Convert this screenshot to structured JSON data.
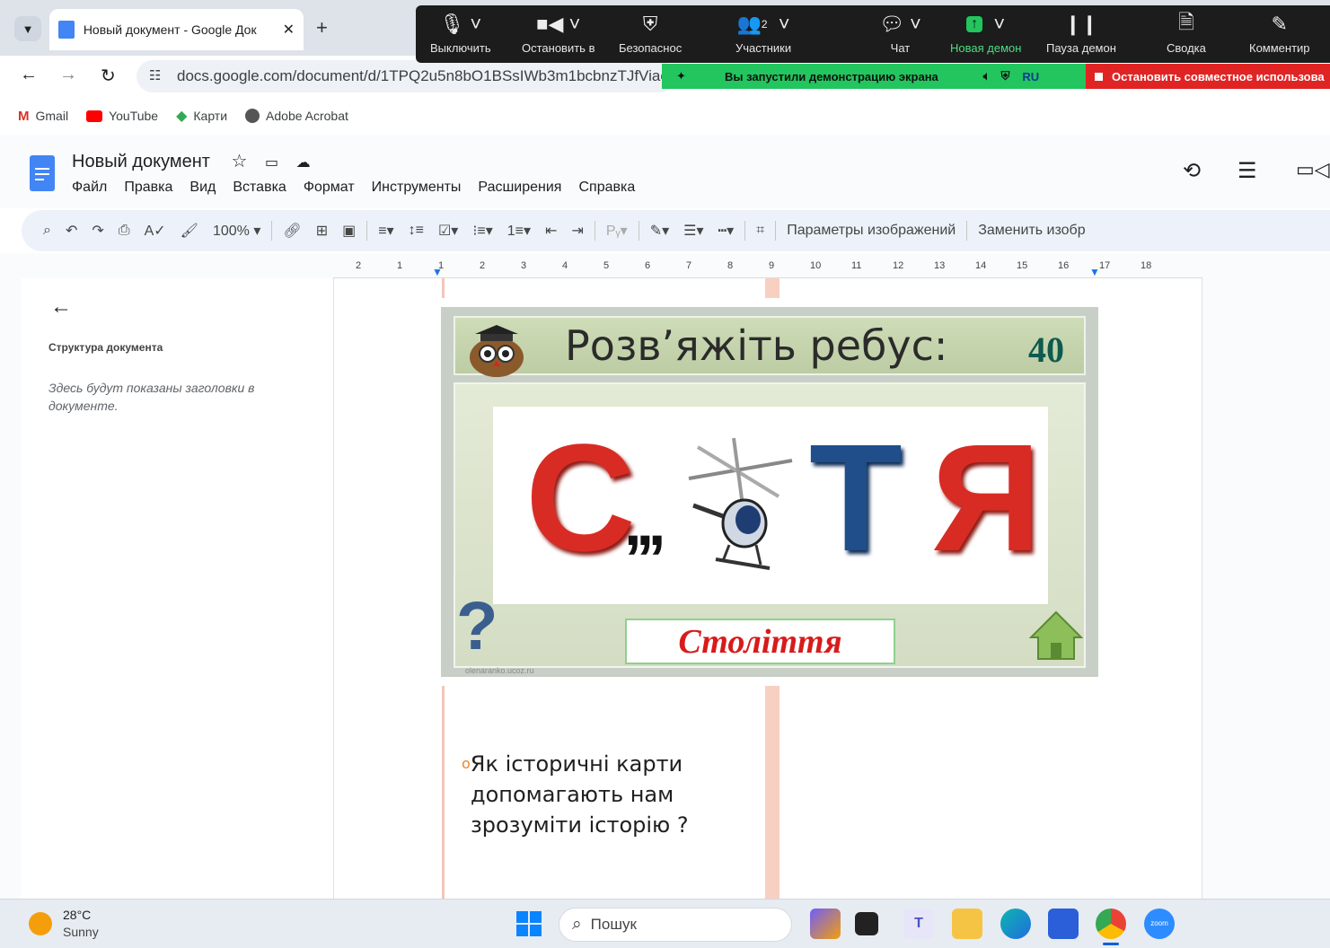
{
  "browser": {
    "tab_title": "Новый документ - Google Док",
    "url": "docs.google.com/document/d/1TPQ2u5n8bO1BSsIWb3m1bcbnzTJfViao",
    "bookmarks": [
      {
        "label": "Gmail",
        "icon": "gmail-icon"
      },
      {
        "label": "YouTube",
        "icon": "youtube-icon"
      },
      {
        "label": "Карти",
        "icon": "maps-icon"
      },
      {
        "label": "Adobe Acrobat",
        "icon": "acrobat-icon"
      }
    ]
  },
  "zoom": {
    "buttons": [
      {
        "label": "Выключить",
        "icon": "microphone-icon"
      },
      {
        "label": "Остановить в",
        "icon": "video-camera-icon"
      },
      {
        "label": "Безопаснос",
        "icon": "security-shield-icon"
      },
      {
        "label": "Участники",
        "icon": "participants-icon",
        "count": "2"
      },
      {
        "label": "Чат",
        "icon": "chat-icon"
      },
      {
        "label": "Новая демон",
        "icon": "share-screen-icon"
      },
      {
        "label": "Пауза демон",
        "icon": "pause-icon"
      },
      {
        "label": "Сводка",
        "icon": "summary-icon"
      },
      {
        "label": "Комментир",
        "icon": "annotate-pencil-icon"
      }
    ],
    "sharing_text": "Вы запустили демонстрацию экрана",
    "language": "RU",
    "stop_share": "Остановить совместное использова"
  },
  "docs": {
    "title": "Новый документ",
    "menu": [
      "Файл",
      "Правка",
      "Вид",
      "Вставка",
      "Формат",
      "Инструменты",
      "Расширения",
      "Справка"
    ],
    "zoom_level": "100%",
    "image_options": "Параметры изображений",
    "replace_image": "Заменить изобр",
    "ruler_ticks": [
      "2",
      "1",
      "1",
      "2",
      "3",
      "4",
      "5",
      "6",
      "7",
      "8",
      "9",
      "10",
      "11",
      "12",
      "13",
      "14",
      "15",
      "16",
      "17",
      "18"
    ]
  },
  "outline": {
    "heading": "Структура документа",
    "empty_text": "Здесь будут показаны заголовки в документе."
  },
  "slide": {
    "title": "Розв’яжіть ребус:",
    "number": "40",
    "rebus_letter_1": "С",
    "rebus_commas": ",,,",
    "rebus_letter_2": "Т",
    "rebus_letter_3": "Я",
    "answer": "Століття",
    "watermark": "olenaranko.ucoz.ru"
  },
  "body_text": {
    "bullet": "Як історичні карти",
    "line2": "допомагають нам",
    "line3": "зрозуміти історію  ?"
  },
  "taskbar": {
    "temperature": "28°C",
    "weather": "Sunny",
    "search_placeholder": "Пошук"
  },
  "colors": {
    "zoom_bar": "#1c1c1c",
    "share_green": "#22c55e",
    "stop_red": "#e02424",
    "rebus_red": "#d82b24",
    "rebus_blue": "#1f4e8a",
    "answer_red": "#d81b1b"
  }
}
